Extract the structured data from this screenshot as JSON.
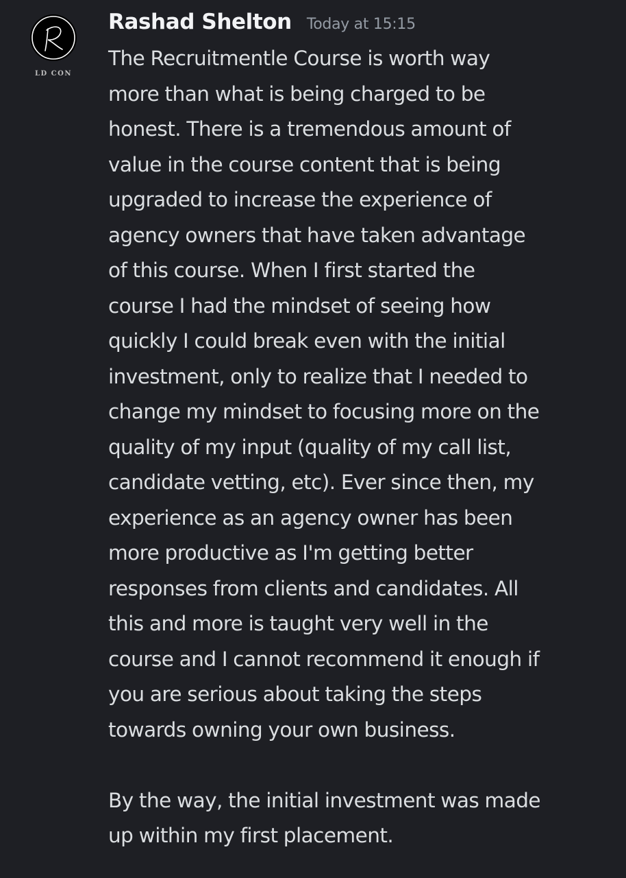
{
  "message": {
    "author": "Rashad Shelton",
    "timestamp": "Today at 15:15",
    "avatar": {
      "icon": "monogram-r-logo-icon",
      "logo_text": "LD CON"
    },
    "paragraphs": [
      {
        "lines": [
          "The Recruitmentle Course is worth way",
          "more than what is being charged to be",
          "honest. There is a tremendous amount of",
          "value in the course content that is being",
          "upgraded to increase the experience of",
          "agency owners that have taken advantage",
          "of this course. When I first started the",
          "course I had the mindset of seeing how",
          "quickly I could break even with the initial",
          "investment, only to realize that I needed to",
          "change my mindset to focusing more on the",
          "quality of my input (quality of my call list,",
          "candidate vetting, etc). Ever since then, my",
          "experience as an agency owner has been",
          "more productive as I'm getting better",
          "responses from clients and candidates. All",
          "this and more is taught very well in the",
          "course and I cannot recommend it enough if",
          "you are serious about taking the steps",
          "towards owning your own business."
        ]
      },
      {
        "lines": [
          "By the way, the initial investment was made",
          "up within my first placement."
        ]
      }
    ]
  },
  "colors": {
    "background": "#1e1f24",
    "username": "#f2f3f5",
    "timestamp": "#949ba4",
    "body_text": "#dbdee1",
    "avatar_bg": "#000000"
  }
}
